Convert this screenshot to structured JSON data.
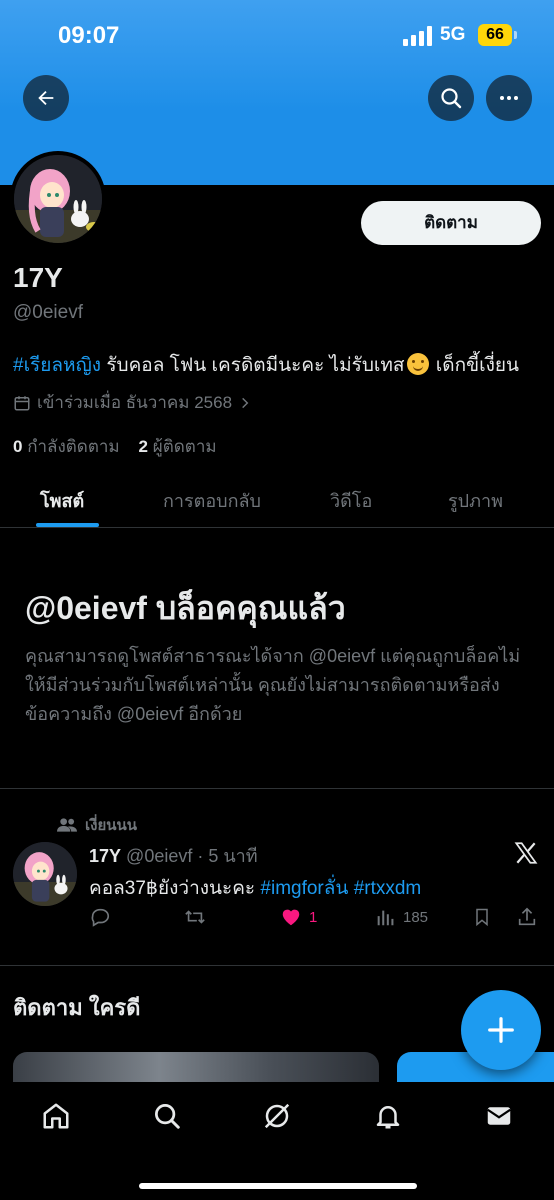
{
  "status_bar": {
    "time": "09:07",
    "network": "5G",
    "battery": "66"
  },
  "profile": {
    "follow_label": "ติดตาม",
    "name": "17Y",
    "handle": "@0eievf",
    "bio_hashtag": "#เรียลหญิง",
    "bio_text": " รับคอล โฟน เครดิตมีนะคะ ไม่รับเทส",
    "bio_text_after": " เด็กขี้เงี่ยน",
    "joined": "เข้าร่วมเมื่อ ธันวาคม 2568",
    "following_count": "0",
    "following_label": "กำลังติดตาม",
    "followers_count": "2",
    "followers_label": "ผู้ติดตาม"
  },
  "tabs": [
    {
      "label": "โพสต์",
      "active": true
    },
    {
      "label": "การตอบกลับ",
      "active": false
    },
    {
      "label": "วิดีโอ",
      "active": false
    },
    {
      "label": "รูปภาพ",
      "active": false
    }
  ],
  "blocked": {
    "title": "@0eievf บล็อคคุณแล้ว",
    "description": "คุณสามารถดูโพสต์สาธารณะได้จาก @0eievf แต่คุณถูกบล็อคไม่ให้มีส่วนร่วมกับโพสต์เหล่านั้น คุณยังไม่สามารถติดตามหรือส่งข้อความถึง @0eievf อีกด้วย"
  },
  "tweet": {
    "reposted_by": "เงี่ยนนน",
    "author_name": "17Y",
    "author_handle": "@0eievf",
    "time": "· 5 นาที",
    "text": "คอล37฿ยังว่างนะคะ ",
    "hashtag1": "#imgforลั่น",
    "hashtag2": "#rtxxdm",
    "likes": "1",
    "views": "185"
  },
  "who_to_follow": {
    "title": "ติดตาม ใครดี"
  },
  "colors": {
    "accent": "#1d9bf0",
    "like": "#f91880",
    "muted": "#71767b",
    "text": "#e7e9ea"
  }
}
